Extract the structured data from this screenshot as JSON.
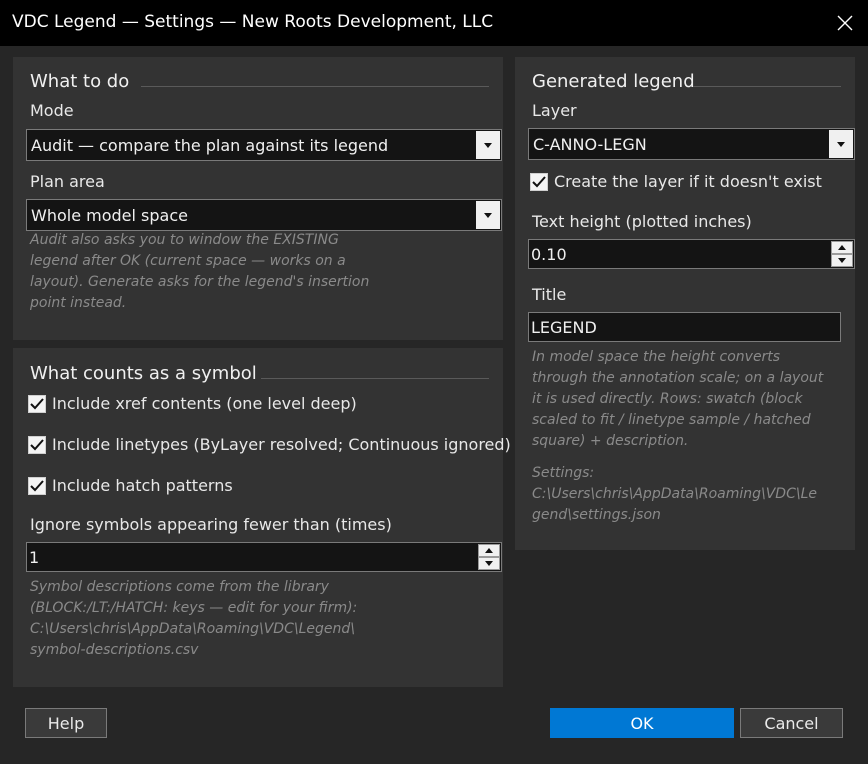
{
  "window": {
    "title": "VDC Legend — Settings — New Roots Development, LLC",
    "close_icon": "close-icon"
  },
  "what_to_do": {
    "title": "What to do",
    "mode_label": "Mode",
    "mode_value": "Audit — compare the plan against its legend",
    "plan_area_label": "Plan area",
    "plan_area_value": "Whole model space",
    "hint": "Audit also asks you to window the EXISTING\nlegend after OK (current space — works on a\nlayout). Generate asks for the legend's insertion\npoint instead."
  },
  "symbols": {
    "title": "What counts as a symbol",
    "include_xref": {
      "label": "Include xref contents (one level deep)",
      "checked": true
    },
    "include_linetypes": {
      "label": "Include linetypes (ByLayer resolved; Continuous ignored)",
      "checked": true
    },
    "include_hatch": {
      "label": "Include hatch patterns",
      "checked": true
    },
    "ignore_label": "Ignore symbols appearing fewer than (times)",
    "ignore_value": "1",
    "hint": "Symbol descriptions come from the library\n(BLOCK:/LT:/HATCH:  keys — edit for your firm):\nC:\\Users\\chris\\AppData\\Roaming\\VDC\\Legend\\\nsymbol-descriptions.csv"
  },
  "generated": {
    "title": "Generated legend",
    "layer_label": "Layer",
    "layer_value": "C-ANNO-LEGN",
    "create_layer": {
      "label": "Create the layer if it doesn't exist",
      "checked": true
    },
    "text_height_label": "Text height (plotted inches)",
    "text_height_value": "0.10",
    "title_label": "Title",
    "title_value": "LEGEND",
    "hint": "In model space the height converts\nthrough the annotation scale; on a layout\nit is used directly. Rows: swatch (block\nscaled to fit / linetype sample / hatched\nsquare) + description.",
    "settings_hint": "Settings:\nC:\\Users\\chris\\AppData\\Roaming\\VDC\\Le\ngend\\settings.json"
  },
  "buttons": {
    "help": "Help",
    "ok": "OK",
    "cancel": "Cancel"
  },
  "colors": {
    "accent": "#0078d4",
    "panel": "#333333",
    "background": "#262626"
  }
}
